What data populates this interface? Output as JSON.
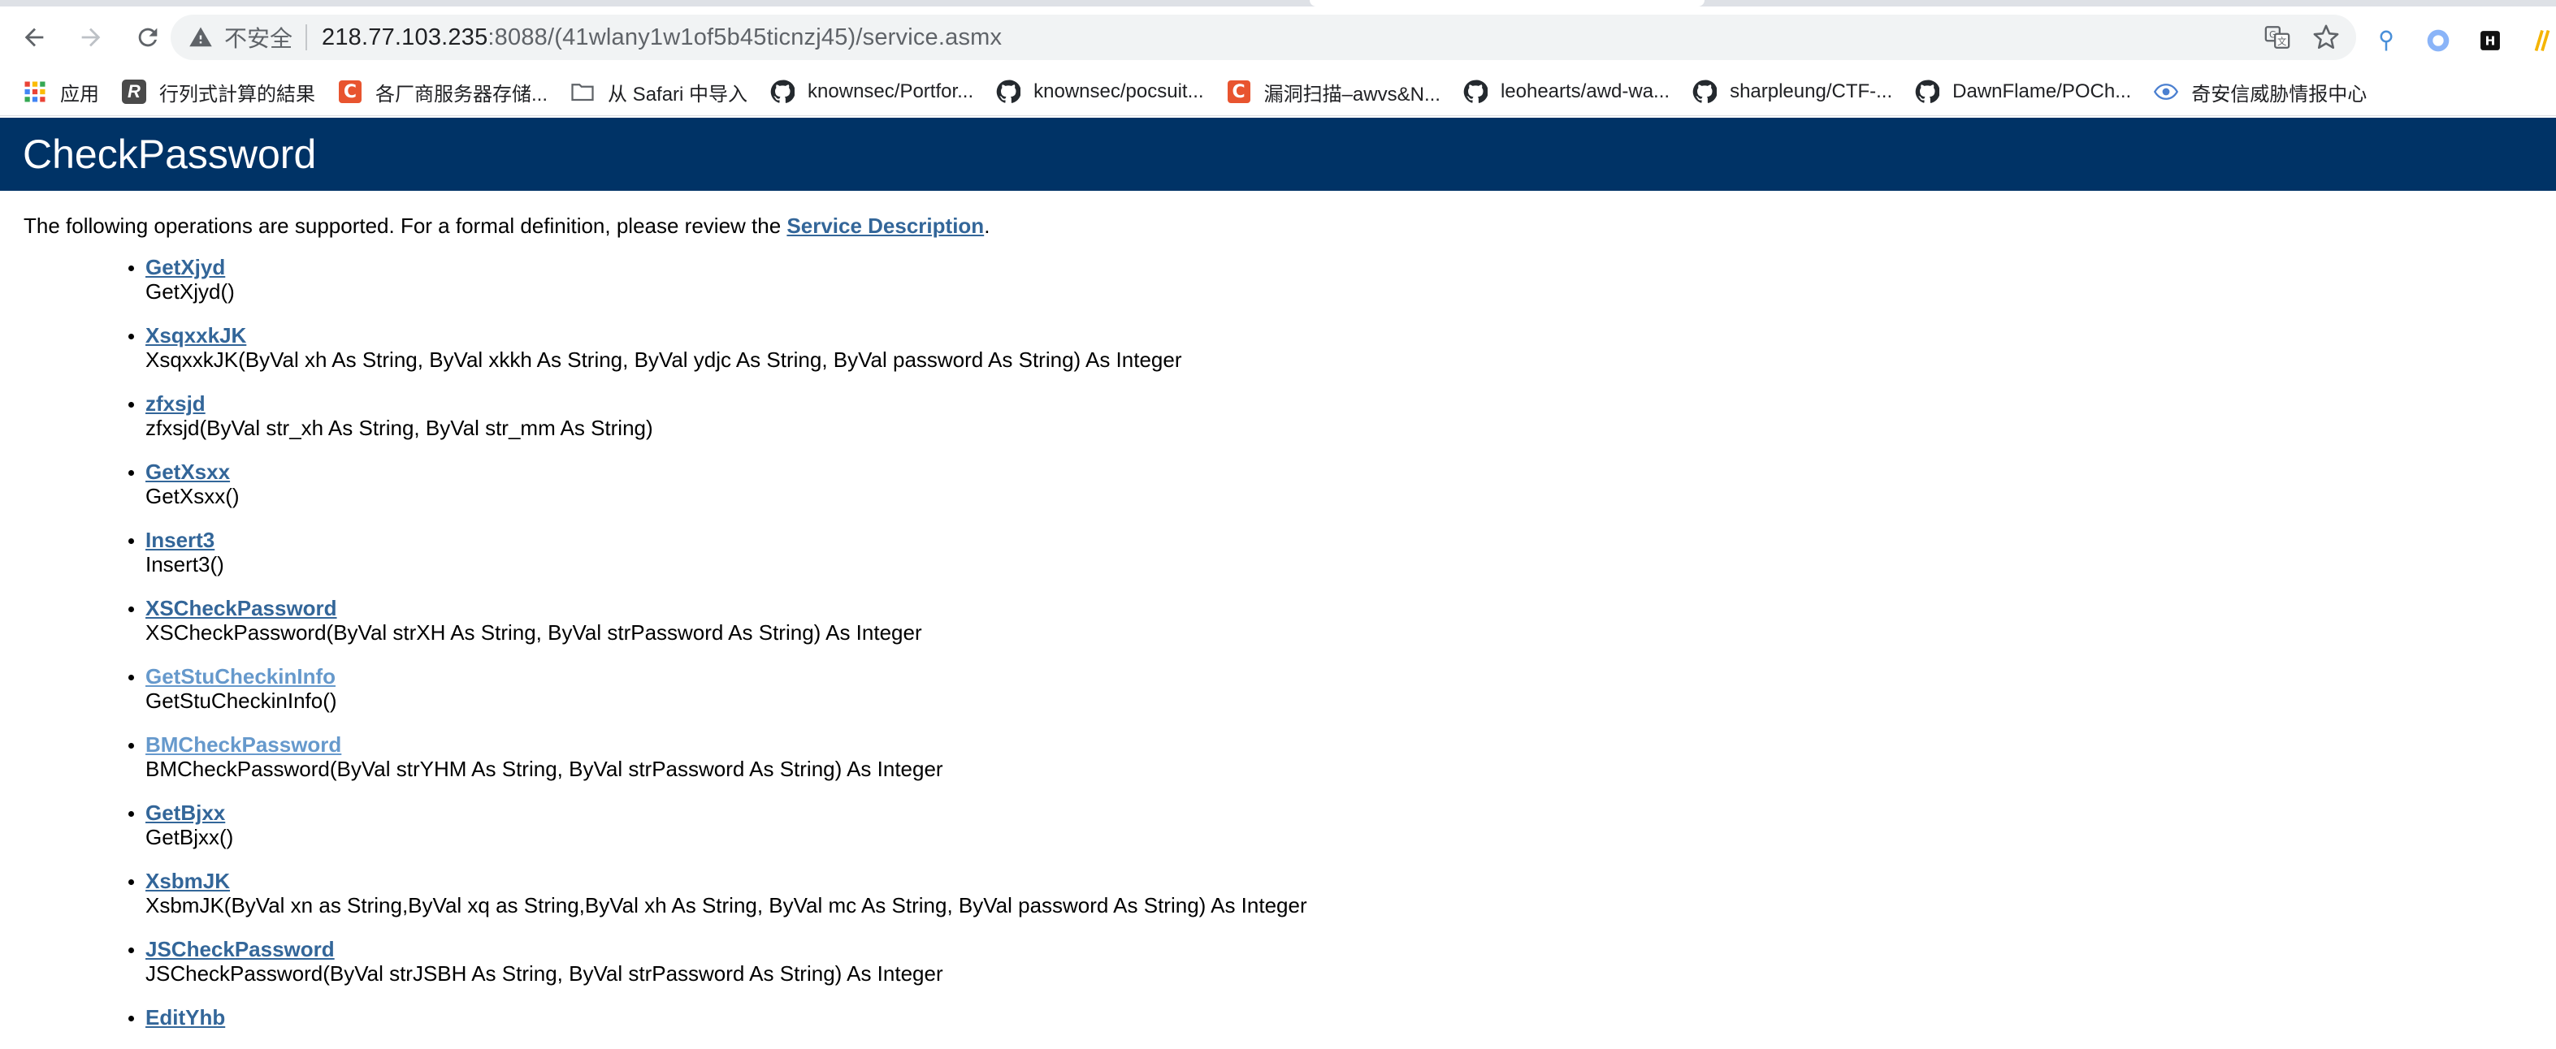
{
  "browser": {
    "security_label": "不安全",
    "url_host": "218.77.103.235",
    "url_rest": ":8088/(41wlany1w1of5b45ticnzj45)/service.asmx"
  },
  "bookmarks": [
    {
      "label": "应用",
      "icon": "apps-grid-icon"
    },
    {
      "label": "行列式計算的結果",
      "icon": "r-logo-icon"
    },
    {
      "label": "各厂商服务器存储...",
      "icon": "c-logo-icon"
    },
    {
      "label": "从 Safari 中导入",
      "icon": "folder-icon"
    },
    {
      "label": "knownsec/Portfor...",
      "icon": "github-icon"
    },
    {
      "label": "knownsec/pocsuit...",
      "icon": "github-icon"
    },
    {
      "label": "漏洞扫描–awvs&N...",
      "icon": "c-logo-icon"
    },
    {
      "label": "leohearts/awd-wa...",
      "icon": "github-icon"
    },
    {
      "label": "sharpleung/CTF-...",
      "icon": "github-icon"
    },
    {
      "label": "DawnFlame/POCh...",
      "icon": "github-icon"
    },
    {
      "label": "奇安信威胁情报中心",
      "icon": "eye-icon"
    }
  ],
  "page": {
    "title": "CheckPassword",
    "intro_before": "The following operations are supported. For a formal definition, please review the ",
    "intro_link": "Service Description",
    "intro_after": ".",
    "operations": [
      {
        "name": "GetXjyd",
        "signature": "GetXjyd()",
        "visited": false
      },
      {
        "name": "XsqxxkJK",
        "signature": "XsqxxkJK(ByVal xh As String, ByVal xkkh As String, ByVal ydjc As String, ByVal password As String) As Integer",
        "visited": false
      },
      {
        "name": "zfxsjd",
        "signature": "zfxsjd(ByVal str_xh As String, ByVal str_mm As String)",
        "visited": false
      },
      {
        "name": "GetXsxx",
        "signature": "GetXsxx()",
        "visited": false
      },
      {
        "name": "Insert3",
        "signature": "Insert3()",
        "visited": false
      },
      {
        "name": "XSCheckPassword",
        "signature": "XSCheckPassword(ByVal strXH As String, ByVal strPassword As String) As Integer",
        "visited": false
      },
      {
        "name": "GetStuCheckinInfo",
        "signature": "GetStuCheckinInfo()",
        "visited": true
      },
      {
        "name": "BMCheckPassword",
        "signature": "BMCheckPassword(ByVal strYHM As String, ByVal strPassword As String) As Integer",
        "visited": true
      },
      {
        "name": "GetBjxx",
        "signature": "GetBjxx()",
        "visited": false
      },
      {
        "name": "XsbmJK",
        "signature": "XsbmJK(ByVal xn as String,ByVal xq as String,ByVal xh As String, ByVal mc As String, ByVal password As String) As Integer",
        "visited": false
      },
      {
        "name": "JSCheckPassword",
        "signature": "JSCheckPassword(ByVal strJSBH As String, ByVal strPassword As String) As Integer",
        "visited": false
      },
      {
        "name": "EditYhb",
        "signature": "",
        "visited": false
      }
    ]
  }
}
